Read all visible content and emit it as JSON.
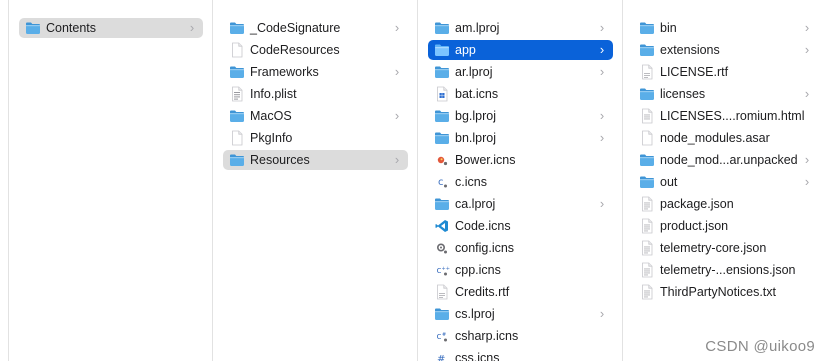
{
  "window": {
    "left_edge_line": true
  },
  "columns": [
    {
      "name": "column-1",
      "items": [
        {
          "label": "Contents",
          "kind": "folder",
          "chevron": true,
          "state": "inactive"
        }
      ]
    },
    {
      "name": "column-2",
      "items": [
        {
          "label": "_CodeSignature",
          "kind": "folder",
          "chevron": true
        },
        {
          "label": "CodeResources",
          "kind": "file-blank",
          "chevron": false
        },
        {
          "label": "Frameworks",
          "kind": "folder",
          "chevron": true
        },
        {
          "label": "Info.plist",
          "kind": "file-plist",
          "chevron": false
        },
        {
          "label": "MacOS",
          "kind": "folder",
          "chevron": true
        },
        {
          "label": "PkgInfo",
          "kind": "file-blank",
          "chevron": false
        },
        {
          "label": "Resources",
          "kind": "folder",
          "chevron": true,
          "state": "inactive"
        }
      ]
    },
    {
      "name": "column-3",
      "items": [
        {
          "label": "am.lproj",
          "kind": "folder",
          "chevron": true
        },
        {
          "label": "app",
          "kind": "folder",
          "chevron": true,
          "state": "active"
        },
        {
          "label": "ar.lproj",
          "kind": "folder",
          "chevron": true
        },
        {
          "label": "bat.icns",
          "kind": "icns-bat",
          "chevron": false
        },
        {
          "label": "bg.lproj",
          "kind": "folder",
          "chevron": true
        },
        {
          "label": "bn.lproj",
          "kind": "folder",
          "chevron": true
        },
        {
          "label": "Bower.icns",
          "kind": "icns-bower",
          "chevron": false
        },
        {
          "label": "c.icns",
          "kind": "icns-c",
          "chevron": false
        },
        {
          "label": "ca.lproj",
          "kind": "folder",
          "chevron": true
        },
        {
          "label": "Code.icns",
          "kind": "icns-code",
          "chevron": false
        },
        {
          "label": "config.icns",
          "kind": "icns-config",
          "chevron": false
        },
        {
          "label": "cpp.icns",
          "kind": "icns-cpp",
          "chevron": false
        },
        {
          "label": "Credits.rtf",
          "kind": "file-rtf",
          "chevron": false
        },
        {
          "label": "cs.lproj",
          "kind": "folder",
          "chevron": true
        },
        {
          "label": "csharp.icns",
          "kind": "icns-csharp",
          "chevron": false
        },
        {
          "label": "css.icns",
          "kind": "icns-css",
          "chevron": false
        }
      ]
    },
    {
      "name": "column-4",
      "items": [
        {
          "label": "bin",
          "kind": "folder",
          "chevron": true
        },
        {
          "label": "extensions",
          "kind": "folder",
          "chevron": true
        },
        {
          "label": "LICENSE.rtf",
          "kind": "file-rtf",
          "chevron": false
        },
        {
          "label": "licenses",
          "kind": "folder",
          "chevron": true
        },
        {
          "label": "LICENSES....romium.html",
          "kind": "file-html",
          "chevron": false
        },
        {
          "label": "node_modules.asar",
          "kind": "file-blank",
          "chevron": false
        },
        {
          "label": "node_mod...ar.unpacked",
          "kind": "folder",
          "chevron": true
        },
        {
          "label": "out",
          "kind": "folder",
          "chevron": true
        },
        {
          "label": "package.json",
          "kind": "file-doc",
          "chevron": false
        },
        {
          "label": "product.json",
          "kind": "file-doc",
          "chevron": false
        },
        {
          "label": "telemetry-core.json",
          "kind": "file-doc",
          "chevron": false
        },
        {
          "label": "telemetry-...ensions.json",
          "kind": "file-doc",
          "chevron": false
        },
        {
          "label": "ThirdPartyNotices.txt",
          "kind": "file-doc",
          "chevron": false
        }
      ]
    }
  ],
  "watermark": "CSDN @uikoo9",
  "colors": {
    "folder": "#5aaee8",
    "folder_dark": "#3f95d6",
    "selection_active": "#0a62d9",
    "selection_inactive": "#dcdcdc",
    "chevron": "#a8a8ad"
  }
}
